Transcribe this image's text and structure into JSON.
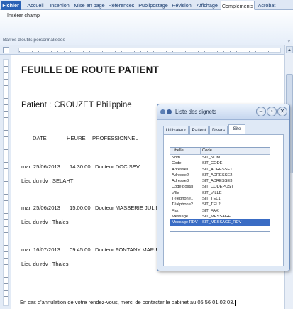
{
  "ribbon": {
    "tabs": [
      {
        "label": "Fichier"
      },
      {
        "label": "Accueil"
      },
      {
        "label": "Insertion"
      },
      {
        "label": "Mise en page"
      },
      {
        "label": "Références"
      },
      {
        "label": "Publipostage"
      },
      {
        "label": "Révision"
      },
      {
        "label": "Affichage"
      },
      {
        "label": "Compléments"
      },
      {
        "label": "Acrobat"
      }
    ],
    "active_tab": "Compléments",
    "button_label": "Insérer champ",
    "group_label": "Barres d'outils personnalisées"
  },
  "document": {
    "title": "FEUILLE DE ROUTE PATIENT",
    "patient_label": "Patient :",
    "patient_lastname": "CROUZET",
    "patient_firstname": "Philippine",
    "headers": {
      "date": "DATE",
      "hour": "HEURE",
      "professional": "PROFESSIONNEL"
    },
    "appointments": [
      {
        "date": "mar. 25/06/2013",
        "time": "14:30:00",
        "professional": "Docteur DOC SEV",
        "location": "Lieu du rdv : SELAHT"
      },
      {
        "date": "mar. 25/06/2013",
        "time": "15:00:00",
        "professional": "Docteur MASSERIE JULIEN",
        "location": "Lieu du rdv : Thales"
      },
      {
        "date": "mar. 16/07/2013",
        "time": "09:45:00",
        "professional": "Docteur FONTANY MARIE",
        "location": "Lieu du rdv : Thales"
      }
    ],
    "footer": "En cas d'annulation de votre rendez-vous, merci de contacter le cabinet au 05 56 01 02 03."
  },
  "dialog": {
    "title": "Liste des signets",
    "tabs": [
      {
        "label": "Utilisateur"
      },
      {
        "label": "Patient"
      },
      {
        "label": "Divers"
      },
      {
        "label": "Site"
      }
    ],
    "active_tab": "Site",
    "columns": {
      "libelle": "Libelle",
      "code": "Code"
    },
    "rows": [
      {
        "libelle": "Nom",
        "code": "SIT_NOM"
      },
      {
        "libelle": "Code",
        "code": "SIT_CODE"
      },
      {
        "libelle": "Adresse1",
        "code": "SIT_ADRESSE1"
      },
      {
        "libelle": "Adresse2",
        "code": "SIT_ADRESSE2"
      },
      {
        "libelle": "Adresse3",
        "code": "SIT_ADRESSE3"
      },
      {
        "libelle": "Code postal",
        "code": "SIT_CODEPOST"
      },
      {
        "libelle": "Ville",
        "code": "SIT_VILLE"
      },
      {
        "libelle": "Téléphone1",
        "code": "SIT_TEL1"
      },
      {
        "libelle": "Téléphone2",
        "code": "SIT_TEL2"
      },
      {
        "libelle": "Fax",
        "code": "SIT_FAX"
      },
      {
        "libelle": "Message",
        "code": "SIT_MESSAGE"
      },
      {
        "libelle": "Message RDV",
        "code": "SIT_MESSAGE_RDV"
      }
    ],
    "selected_row": "Message RDV",
    "icons": {
      "minimize": "minimize-icon",
      "restore": "restore-icon",
      "close": "close-icon"
    }
  },
  "colors": {
    "file_tab": "#2a62b6",
    "selection": "#3a6cc4",
    "ribbon_bg": "#dfe8f5"
  }
}
